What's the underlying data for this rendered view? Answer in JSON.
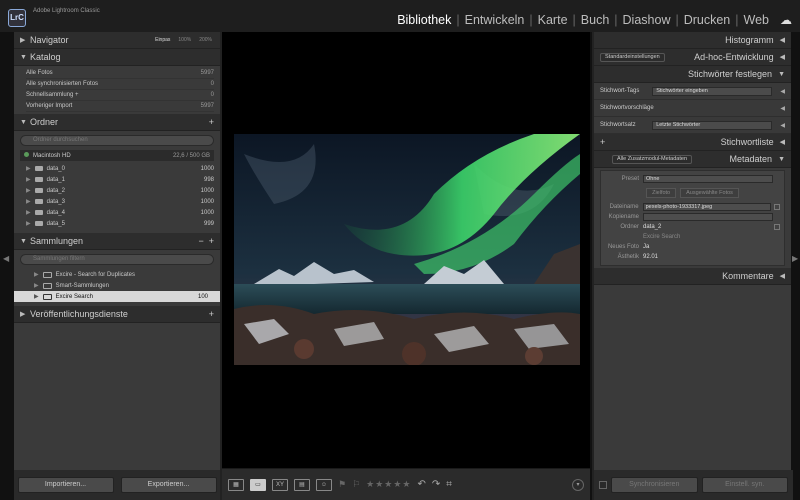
{
  "app": {
    "logo": "LrC",
    "title": "Adobe Lightroom Classic"
  },
  "modules": [
    "Bibliothek",
    "Entwickeln",
    "Karte",
    "Buch",
    "Diashow",
    "Drucken",
    "Web"
  ],
  "active_module": "Bibliothek",
  "navigator": {
    "title": "Navigator",
    "zoom": [
      "Einpas",
      "100%",
      "200%"
    ]
  },
  "katalog": {
    "title": "Katalog",
    "items": [
      {
        "label": "Alle Fotos",
        "count": "5997"
      },
      {
        "label": "Alle synchronisierten Fotos",
        "count": "0"
      },
      {
        "label": "Schnellsammlung +",
        "count": "0"
      },
      {
        "label": "Vorheriger Import",
        "count": "5997"
      }
    ]
  },
  "ordner": {
    "title": "Ordner",
    "search_placeholder": "Ordner durchsuchen",
    "drive": {
      "name": "Macintosh HD",
      "info": "22,6 / 500 GB"
    },
    "folders": [
      {
        "name": "data_0",
        "count": "1000"
      },
      {
        "name": "data_1",
        "count": "998"
      },
      {
        "name": "data_2",
        "count": "1000"
      },
      {
        "name": "data_3",
        "count": "1000"
      },
      {
        "name": "data_4",
        "count": "1000"
      },
      {
        "name": "data_5",
        "count": "999"
      }
    ]
  },
  "sammlungen": {
    "title": "Sammlungen",
    "search_placeholder": "Sammlungen filtern",
    "items": [
      {
        "name": "Excire - Search for Duplicates",
        "count": ""
      },
      {
        "name": "Smart-Sammlungen",
        "count": ""
      },
      {
        "name": "Excire Search",
        "count": "100"
      }
    ]
  },
  "veroeffentlichung": {
    "title": "Veröffentlichungsdienste"
  },
  "left_buttons": {
    "import": "Importieren...",
    "export": "Exportieren..."
  },
  "right": {
    "histogram": "Histogramm",
    "adhoc": "Ad-hoc-Entwicklung",
    "adhoc_preset": "Standardeinstellungen",
    "keywording": "Stichwörter festlegen",
    "kw_tags_label": "Stichwort-Tags",
    "kw_tags_value": "Stichwörter eingeben",
    "kw_suggestions": "Stichwortvorschläge",
    "kw_set_label": "Stichwortsatz",
    "kw_set_value": "Letzte Stichwörter",
    "keywordlist": "Stichwortliste",
    "metadata": "Metadaten",
    "metadata_source": "Alle Zusatzmodul-Metadaten",
    "preset_label": "Preset",
    "preset_value": "Ohne",
    "btn_target": "Zielfoto",
    "btn_selected": "Ausgewählte Fotos",
    "meta_fields": [
      {
        "label": "Dateiname",
        "value": "pexels-photo-1933317.jpeg"
      },
      {
        "label": "Kopiename",
        "value": ""
      },
      {
        "label": "Ordner",
        "value": "data_2"
      }
    ],
    "excire_title": "Excire Search",
    "excire_fields": [
      {
        "label": "Neues Foto",
        "value": "Ja"
      },
      {
        "label": "Ästhetik",
        "value": "92.01"
      }
    ],
    "comments": "Kommentare",
    "sync_meta": "Synchronisieren",
    "sync_settings": "Einstell. syn."
  },
  "toolbar": {
    "stars": "★★★★★"
  },
  "colors": {
    "accent": "#ffffff",
    "panel": "#3a3a3a",
    "header": "#2d2d2d",
    "aurora": "#3bd36a"
  }
}
